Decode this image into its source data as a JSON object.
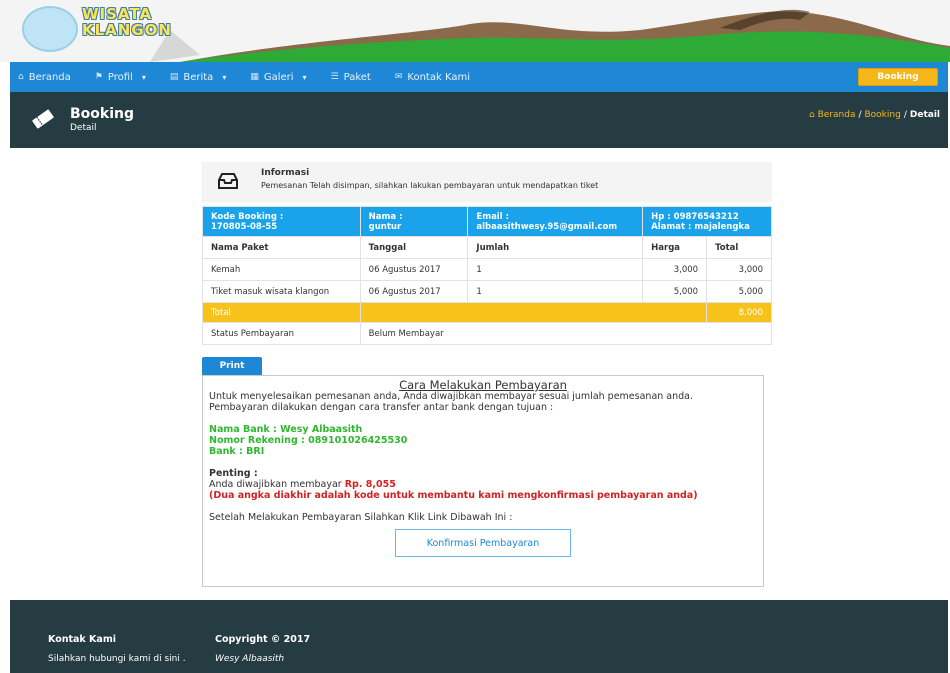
{
  "brand": {
    "line1": "WISATA",
    "line2": "KLANGON"
  },
  "nav": {
    "items": [
      {
        "label": "Beranda",
        "icon": "home-icon",
        "caret": false
      },
      {
        "label": "Profil",
        "icon": "flag-icon",
        "caret": true
      },
      {
        "label": "Berita",
        "icon": "news-icon",
        "caret": true
      },
      {
        "label": "Galeri",
        "icon": "image-icon",
        "caret": true
      },
      {
        "label": "Paket",
        "icon": "list-icon",
        "caret": false
      },
      {
        "label": "Kontak Kami",
        "icon": "chat-icon",
        "caret": false
      }
    ],
    "booking_label": "Booking"
  },
  "page_header": {
    "title": "Booking",
    "subtitle": "Detail",
    "breadcrumb": [
      "Beranda",
      "Booking",
      "Detail"
    ]
  },
  "info": {
    "title": "Informasi",
    "text": "Pemesanan Telah disimpan, silahkan lakukan pembayaran untuk mendapatkan tiket"
  },
  "booking_table": {
    "head": {
      "kode_label": "Kode Booking :",
      "kode_value": "170805-08-55",
      "nama_label": "Nama :",
      "nama_value": "guntur",
      "email_label": "Email :",
      "email_value": "albaasithwesy.95@gmail.com",
      "hp": "Hp : 09876543212",
      "alamat": "Alamat : majalengka"
    },
    "columns": [
      "Nama Paket",
      "Tanggal",
      "Jumlah",
      "Harga",
      "Total"
    ],
    "rows": [
      {
        "paket": "Kemah",
        "tanggal": "06 Agustus 2017",
        "jumlah": "1",
        "harga": "3,000",
        "total": "3,000"
      },
      {
        "paket": "Tiket masuk wisata klangon",
        "tanggal": "06 Agustus 2017",
        "jumlah": "1",
        "harga": "5,000",
        "total": "5,000"
      }
    ],
    "total_label": "Total",
    "total_value": "8,000",
    "status_label": "Status Pembayaran",
    "status_value": "Belum Membayar"
  },
  "print_label": "Print",
  "payment": {
    "title": "Cara Melakukan Pembayaran",
    "intro": "Untuk menyelesaikan pemesanan anda, Anda diwajibkan membayar sesuai jumlah pemesanan anda.",
    "transfer": "Pembayaran dilakukan dengan cara transfer antar bank dengan tujuan :",
    "bank_name": "Nama Bank : Wesy Albaasith",
    "account": "Nomor Rekening : 089101026425530",
    "bank": "Bank : BRI",
    "penting": "Penting :",
    "must_pay": "Anda diwajibkan membayar ",
    "amount": "Rp. 8,055",
    "note": "(Dua angka diakhir adalah kode untuk membantu kami mengkonfirmasi pembayaran anda)",
    "after": "Setelah Melakukan Pembayaran Silahkan Klik Link Dibawah Ini :",
    "confirm_label": "Konfirmasi Pembayaran"
  },
  "footer": {
    "contact_title": "Kontak Kami",
    "contact_text": "Silahkan hubungi kami di sini .",
    "copyright_title": "Copyright © 2017",
    "copyright_text": "Wesy Albaasith"
  },
  "colors": {
    "primary": "#1e88d7",
    "accent": "#f5b61b",
    "dark": "#263c43",
    "table_head": "#1aa3ea",
    "success": "#2eb82e",
    "danger": "#d32222"
  }
}
